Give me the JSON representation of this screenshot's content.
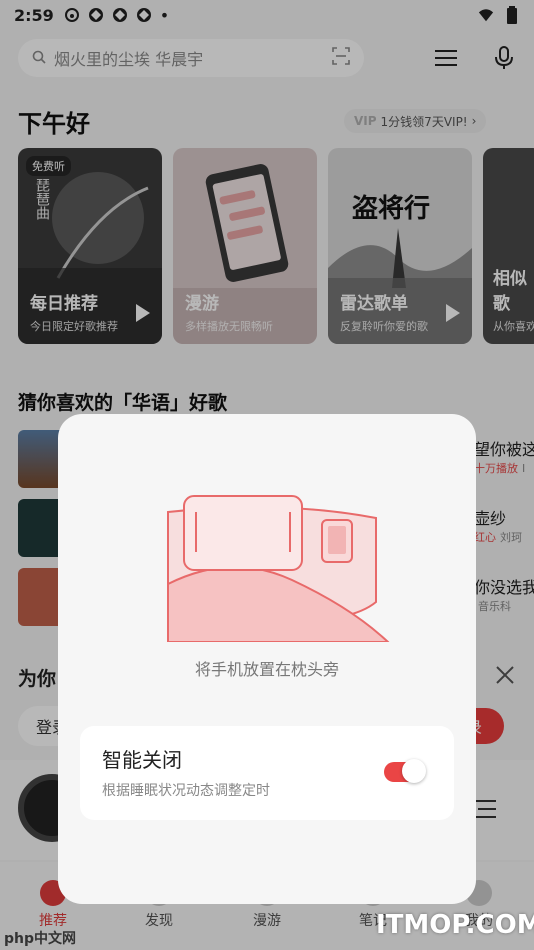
{
  "status_bar": {
    "time": "2:59",
    "dot": "•"
  },
  "search": {
    "placeholder": "烟火里的尘埃 华晨宇"
  },
  "greeting": "下午好",
  "vip_promo": {
    "badge": "VIP",
    "text": "1分钱领7天VIP!"
  },
  "cards": [
    {
      "title": "每日推荐",
      "subtitle": "今日限定好歌推荐",
      "badge": "免费听",
      "art_text": "琵琶曲"
    },
    {
      "title": "漫游",
      "subtitle": "多样播放无限畅听"
    },
    {
      "title": "雷达歌单",
      "subtitle": "反复聆听你爱的歌",
      "art_text": "盗将行"
    },
    {
      "title": "相似歌",
      "subtitle": "从你喜欢"
    }
  ],
  "section_guess": {
    "title": "猜你喜欢的「华语」好歌"
  },
  "songs_right": [
    {
      "title": "望你被这",
      "tag": "十万播放",
      "sub": "Ⅰ"
    },
    {
      "title": "壶纱",
      "tag": "红心",
      "sub": "刘珂"
    },
    {
      "title": "你没选我",
      "tag": "",
      "sub": "音乐科"
    }
  ],
  "for_you": {
    "title": "为你",
    "login_text": "登录",
    "login_button": "录"
  },
  "modal": {
    "hint": "将手机放置在枕头旁",
    "setting_title": "智能关闭",
    "setting_desc": "根据睡眠状况动态调整定时",
    "toggle_on": true
  },
  "tabs": [
    {
      "label": "推荐",
      "active": true
    },
    {
      "label": "发现",
      "active": false
    },
    {
      "label": "漫游",
      "active": false
    },
    {
      "label": "笔记",
      "active": false
    },
    {
      "label": "我的",
      "active": false
    }
  ],
  "watermarks": {
    "left": "php中文网",
    "right": "ITMOP.COM"
  },
  "colors": {
    "accent": "#e83c3c",
    "toggle": "#ea4545"
  }
}
